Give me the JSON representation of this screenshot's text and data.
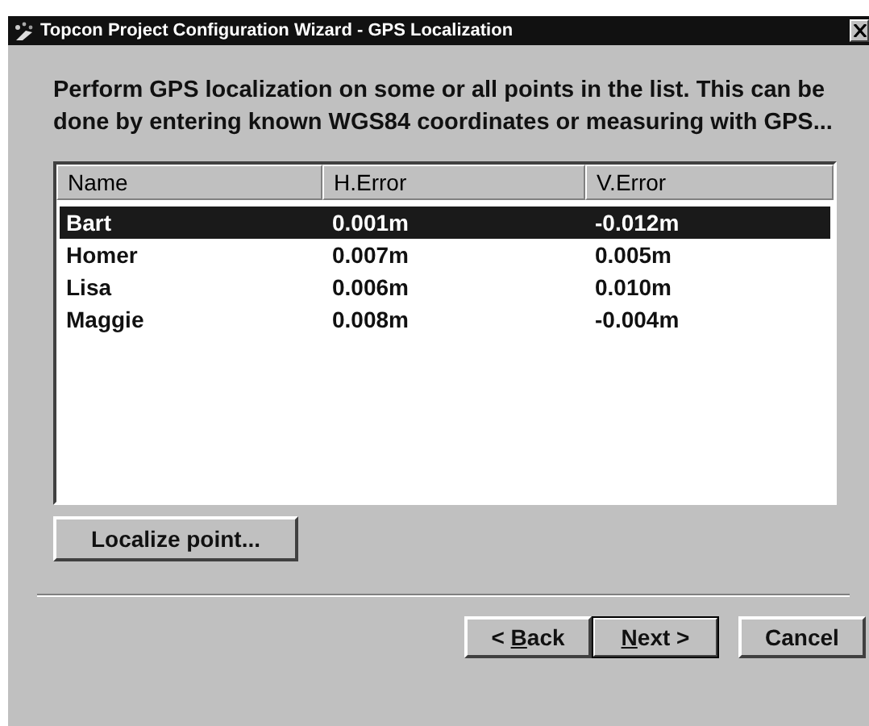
{
  "window": {
    "title": "Topcon Project Configuration Wizard - GPS Localization"
  },
  "instructions": "Perform GPS localization on some or all points in the list. This can be done by entering known WGS84 coordinates or measuring with GPS...",
  "table": {
    "columns": [
      "Name",
      "H.Error",
      "V.Error"
    ],
    "rows": [
      {
        "cells": [
          "Bart",
          "0.001m",
          "-0.012m"
        ],
        "selected": true
      },
      {
        "cells": [
          "Homer",
          "0.007m",
          "0.005m"
        ],
        "selected": false
      },
      {
        "cells": [
          "Lisa",
          "0.006m",
          "0.010m"
        ],
        "selected": false
      },
      {
        "cells": [
          "Maggie",
          "0.008m",
          "-0.004m"
        ],
        "selected": false
      }
    ]
  },
  "action_button": "Localize point...",
  "nav_buttons": [
    {
      "before": "< ",
      "key": "B",
      "after": "ack",
      "default": false
    },
    {
      "key": "N",
      "after": "ext >",
      "default": true
    },
    {
      "before": "Cancel",
      "default": false
    }
  ]
}
